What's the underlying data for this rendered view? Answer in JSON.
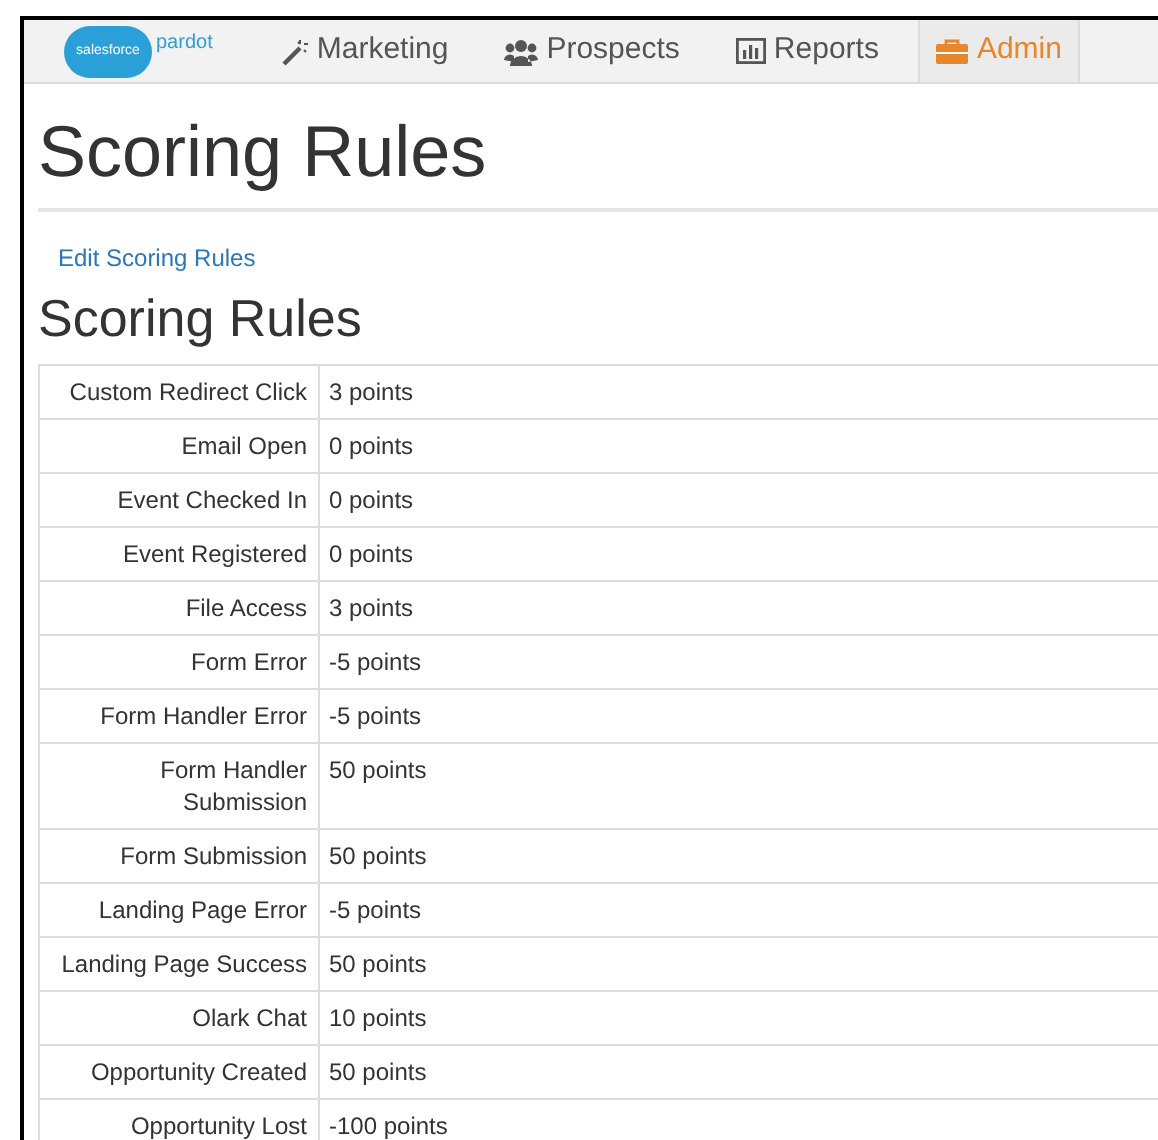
{
  "nav": {
    "logo": {
      "brand": "salesforce",
      "product": "pardot"
    },
    "tabs": [
      {
        "label": "Marketing",
        "selected": false
      },
      {
        "label": "Prospects",
        "selected": false
      },
      {
        "label": "Reports",
        "selected": false
      },
      {
        "label": "Admin",
        "selected": true
      }
    ]
  },
  "page_title": "Scoring Rules",
  "edit_link": "Edit Scoring Rules",
  "section_title": "Scoring Rules",
  "rules": [
    {
      "name": "Custom Redirect Click",
      "points": "3 points"
    },
    {
      "name": "Email Open",
      "points": "0 points"
    },
    {
      "name": "Event Checked In",
      "points": "0 points"
    },
    {
      "name": "Event Registered",
      "points": "0 points"
    },
    {
      "name": "File Access",
      "points": "3 points"
    },
    {
      "name": "Form Error",
      "points": "-5 points"
    },
    {
      "name": "Form Handler Error",
      "points": "-5 points"
    },
    {
      "name": "Form Handler Submission",
      "points": "50 points"
    },
    {
      "name": "Form Submission",
      "points": "50 points"
    },
    {
      "name": "Landing Page Error",
      "points": "-5 points"
    },
    {
      "name": "Landing Page Success",
      "points": "50 points"
    },
    {
      "name": "Olark Chat",
      "points": "10 points"
    },
    {
      "name": "Opportunity Created",
      "points": "50 points"
    },
    {
      "name": "Opportunity Lost",
      "points": "-100 points"
    }
  ]
}
